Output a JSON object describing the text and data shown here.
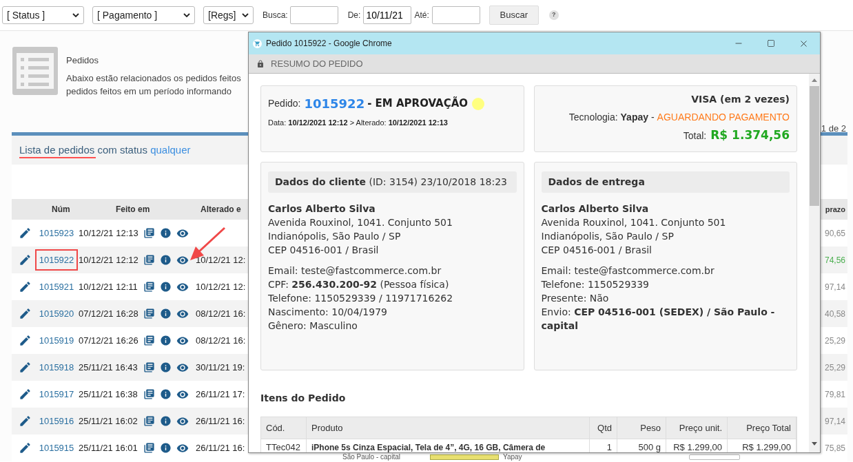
{
  "filters": {
    "selects": [
      "[ Status ]",
      "[ Pagamento ]",
      "[Regs]"
    ],
    "search_label": "Busca:",
    "from_label": "De:",
    "from_value": "10/11/21",
    "to_label": "Até:",
    "search_button": "Buscar",
    "help": "?"
  },
  "page_header": {
    "title": "Pedidos",
    "description_lines": [
      "Abaixo estão relacionados os pedidos feitos",
      "pedidos feitos em um período informando"
    ]
  },
  "list": {
    "title": "Lista de pedidos com status",
    "status": "qualquer",
    "pager": "1 de 2",
    "columns": [
      "Núm",
      "Feito em",
      "Alterado e",
      "prazo"
    ],
    "rows": [
      {
        "number": "1015923",
        "made": "10/12/21 12:13",
        "changed": "",
        "value": "90,65",
        "color": "#888888",
        "marked": false
      },
      {
        "number": "1015922",
        "made": "10/12/21 12:12",
        "changed": "10/12/21 12:",
        "value": "74,56",
        "color": "#4caf50",
        "marked": true
      },
      {
        "number": "1015921",
        "made": "10/12/21 12:11",
        "changed": "10/12/21 12:",
        "value": "97,14",
        "color": "#888888",
        "marked": false
      },
      {
        "number": "1015920",
        "made": "07/12/21 16:28",
        "changed": "08/12/21 16:",
        "value": "40,58",
        "color": "#888888",
        "marked": false
      },
      {
        "number": "1015919",
        "made": "07/12/21 16:26",
        "changed": "08/12/21 16:",
        "value": "25,29",
        "color": "#888888",
        "marked": false
      },
      {
        "number": "1015918",
        "made": "25/11/21 16:43",
        "changed": "30/11/21 19:",
        "value": "25,29",
        "color": "#888888",
        "marked": false
      },
      {
        "number": "1015917",
        "made": "25/11/21 16:38",
        "changed": "26/11/21 17:",
        "value": "79,81",
        "color": "#888888",
        "marked": false
      },
      {
        "number": "1015916",
        "made": "25/11/21 16:02",
        "changed": "26/11/21 16:",
        "value": "97,14",
        "color": "#888888",
        "marked": false
      },
      {
        "number": "1015915",
        "made": "25/11/21 16:01",
        "changed": "26/11/21 16:",
        "value": "75,85",
        "color": "#888888",
        "marked": false
      }
    ],
    "covered_row": {
      "city": "São Paulo - capital",
      "technology": "Yapay"
    }
  },
  "popup": {
    "window_title": "Pedido 1015922 - Google Chrome",
    "address": "RESUMO DO PEDIDO",
    "order": {
      "label": "Pedido:",
      "number": "1015922",
      "status": "- EM APROVAÇÃO",
      "color": "#ffff80",
      "dates": "Data: **10/12/2021 12:12** > Alterado: **10/12/2021 12:13**"
    },
    "payment": {
      "method": "VISA (em 2 vezes)",
      "technology": "Tecnologia: **Yapay** -",
      "payment_status": "AGUARDANDO PAGAMENTO",
      "total_label": "Total:",
      "total": "R$ 1.374,56"
    },
    "client": {
      "heading": "**Dados do cliente** (ID: 3154) 23/10/2018 18:23",
      "name": "Carlos Alberto Silva",
      "address": [
        "Avenida Rouxinol, 1041. Conjunto 501",
        "Indianópolis, São Paulo / SP",
        "CEP 04516-001 / Brasil"
      ],
      "details": [
        "Email: teste@fastcommerce.com.br",
        "CPF: **256.430.200-92** (Pessoa física)",
        "Telefone: 1150529339 / 11971716262",
        "Nascimento: 10/04/1979",
        "Gênero: Masculino"
      ]
    },
    "delivery": {
      "heading": "**Dados de entrega**",
      "name": "Carlos Alberto Silva",
      "address": [
        "Avenida Rouxinol, 1041. Conjunto 501",
        "Indianópolis, São Paulo / SP",
        "CEP 04516-001 / Brasil"
      ],
      "details": [
        "Email: teste@fastcommerce.com.br",
        "Telefone: 1150529339",
        "Presente: Não",
        "Envio: **CEP 04516-001 (SEDEX) / São Paulo - capital**"
      ]
    },
    "items": {
      "title": "Itens do Pedido",
      "columns": [
        "Cód.",
        "Produto",
        "Qtd",
        "Peso",
        "Preço unit.",
        "Preço Total"
      ],
      "rows": [
        [
          "TTec042",
          "iPhone 5s Cinza Espacial, Tela de 4”, 4G, 16 GB, Câmera de",
          "1",
          "500 g",
          "R$ 1.299,00",
          "R$ 1.299,00"
        ]
      ]
    }
  }
}
